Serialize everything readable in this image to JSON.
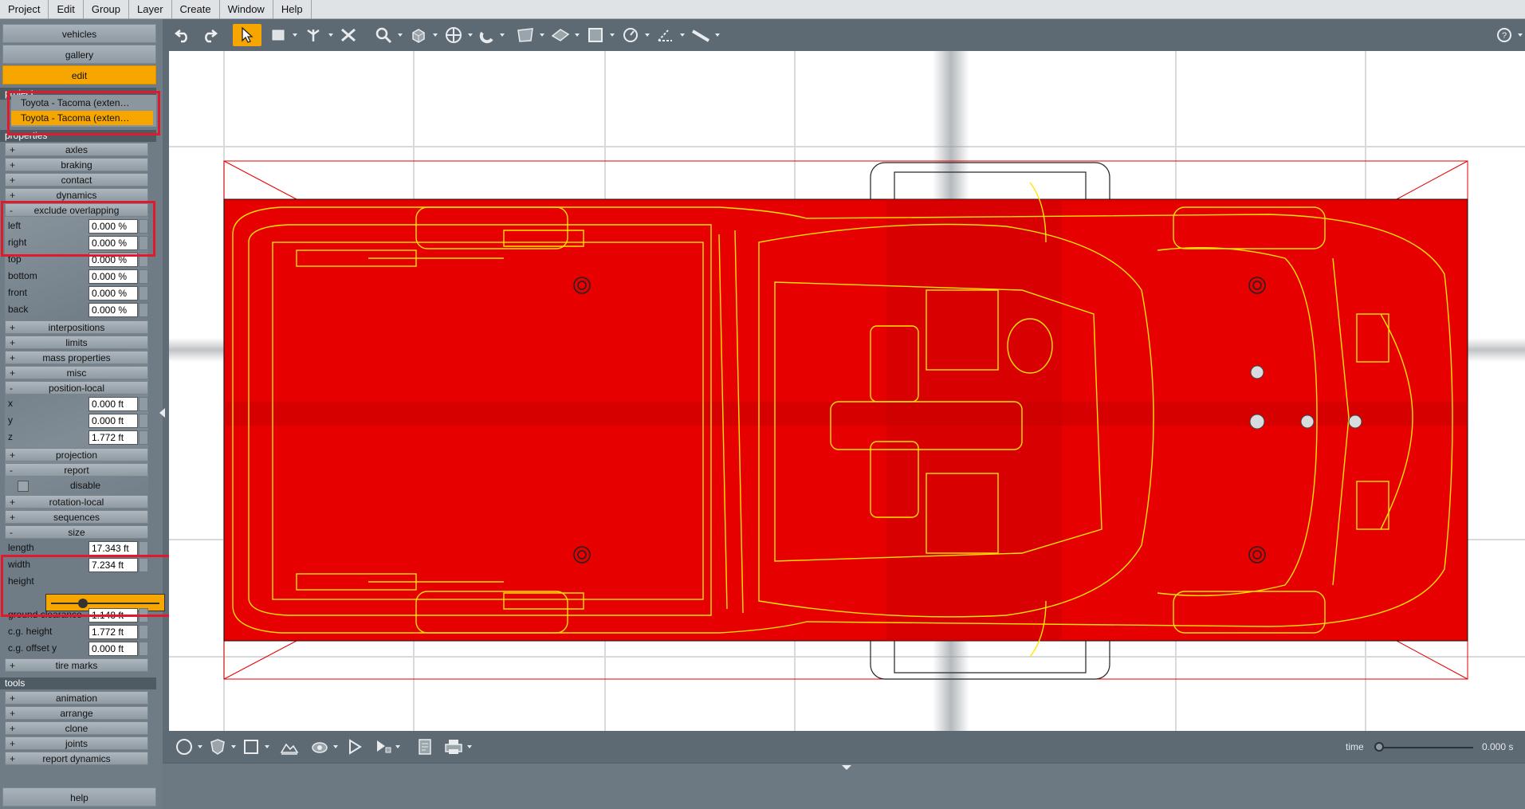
{
  "menubar": [
    "Project",
    "Edit",
    "Group",
    "Layer",
    "Create",
    "Window",
    "Help"
  ],
  "nav": {
    "vehicles": "vehicles",
    "gallery": "gallery",
    "edit": "edit"
  },
  "sections": {
    "project": "project",
    "properties": "properties",
    "tools": "tools"
  },
  "project_items": [
    "Toyota - Tacoma (exten…",
    "Toyota - Tacoma (exten…"
  ],
  "props": {
    "axles": "axles",
    "braking": "braking",
    "contact": "contact",
    "dynamics": "dynamics",
    "exclude_overlapping": "exclude overlapping",
    "left": {
      "label": "left",
      "value": "0.000 %"
    },
    "right": {
      "label": "right",
      "value": "0.000 %"
    },
    "top": {
      "label": "top",
      "value": "0.000 %"
    },
    "bottom": {
      "label": "bottom",
      "value": "0.000 %"
    },
    "front": {
      "label": "front",
      "value": "0.000 %"
    },
    "back": {
      "label": "back",
      "value": "0.000 %"
    },
    "interpositions": "interpositions",
    "limits": "limits",
    "mass_properties": "mass properties",
    "misc": "misc",
    "position_local": "position-local",
    "x": {
      "label": "x",
      "value": "0.000 ft"
    },
    "y": {
      "label": "y",
      "value": "0.000 ft"
    },
    "z": {
      "label": "z",
      "value": "1.772 ft"
    },
    "projection": "projection",
    "report": "report",
    "disable": "disable",
    "rotation_local": "rotation-local",
    "sequences": "sequences",
    "size": "size",
    "length": {
      "label": "length",
      "value": "17.343 ft"
    },
    "width": {
      "label": "width",
      "value": "7.234 ft"
    },
    "height": {
      "label": "height",
      "value": ""
    },
    "ground_clearance": {
      "label": "ground clearance",
      "value": "1.148 ft"
    },
    "cg_height": {
      "label": "c.g. height",
      "value": "1.772 ft"
    },
    "cg_offset_y": {
      "label": "c.g. offset y",
      "value": "0.000 ft"
    },
    "tire_marks": "tire marks"
  },
  "tools": [
    "animation",
    "arrange",
    "clone",
    "joints",
    "report dynamics"
  ],
  "help": "help",
  "timeline": {
    "label": "time",
    "value": "0.000 s"
  },
  "colors": {
    "accent": "#f7a600",
    "overlay": "#e60000",
    "wire": "#ffe600",
    "highlight": "#e0192c"
  }
}
